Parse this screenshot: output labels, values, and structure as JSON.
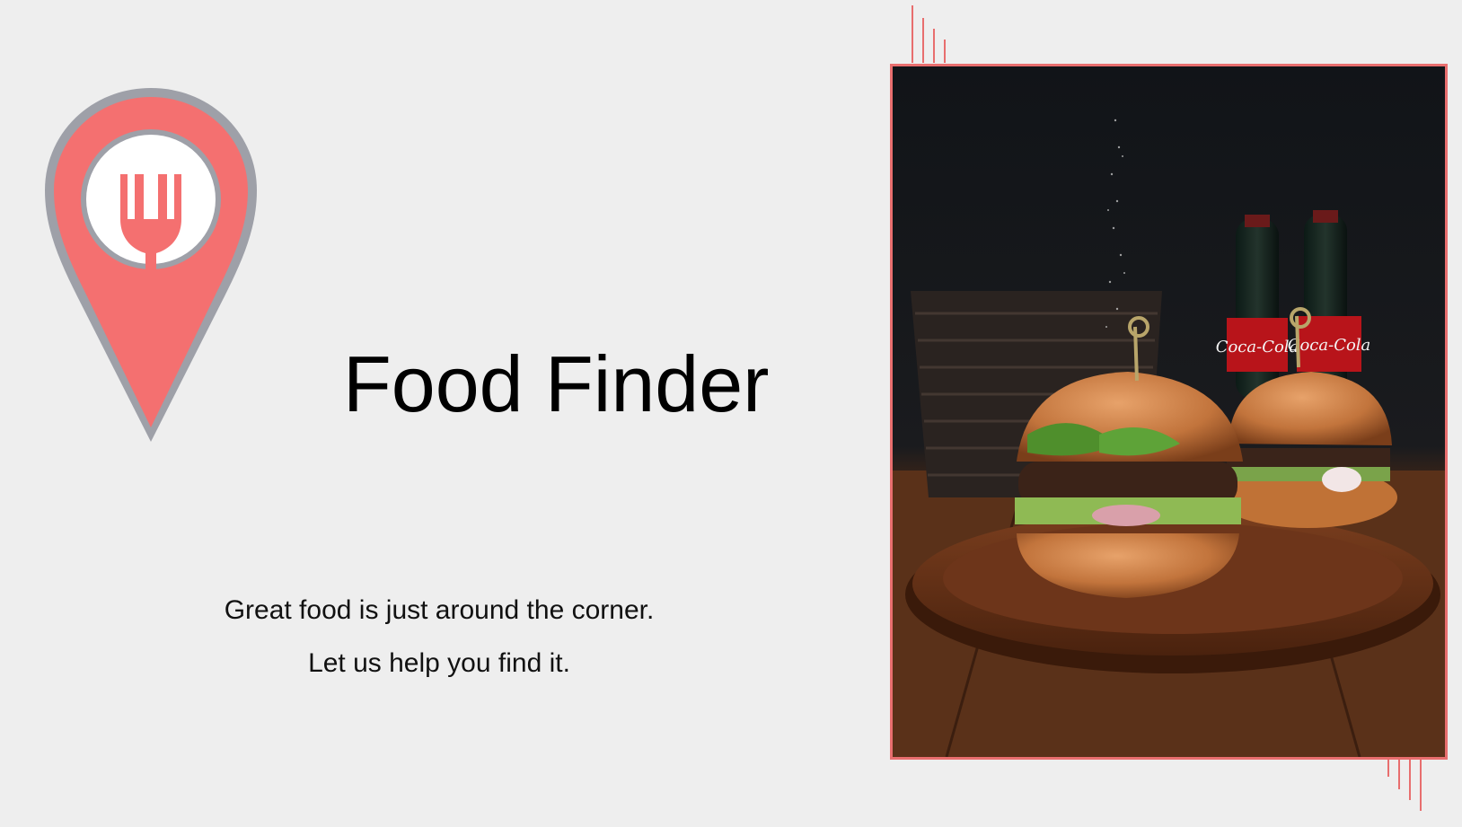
{
  "slide": {
    "title": "Food Finder",
    "tagline_line1": "Great food is just around the corner.",
    "tagline_line2": "Let us help you find it."
  },
  "icons": {
    "logo": "location-pin-fork-icon",
    "photo": "burgers-and-cola-photo",
    "decoration": "vertical-stripes"
  },
  "colors": {
    "background": "#eeeeee",
    "accent": "#f47070",
    "pin_border": "#9ea0a8",
    "frame_border": "#e86e6e",
    "text": "#000000"
  },
  "photo_labels": {
    "bottle_brand": "Coca-Cola"
  }
}
